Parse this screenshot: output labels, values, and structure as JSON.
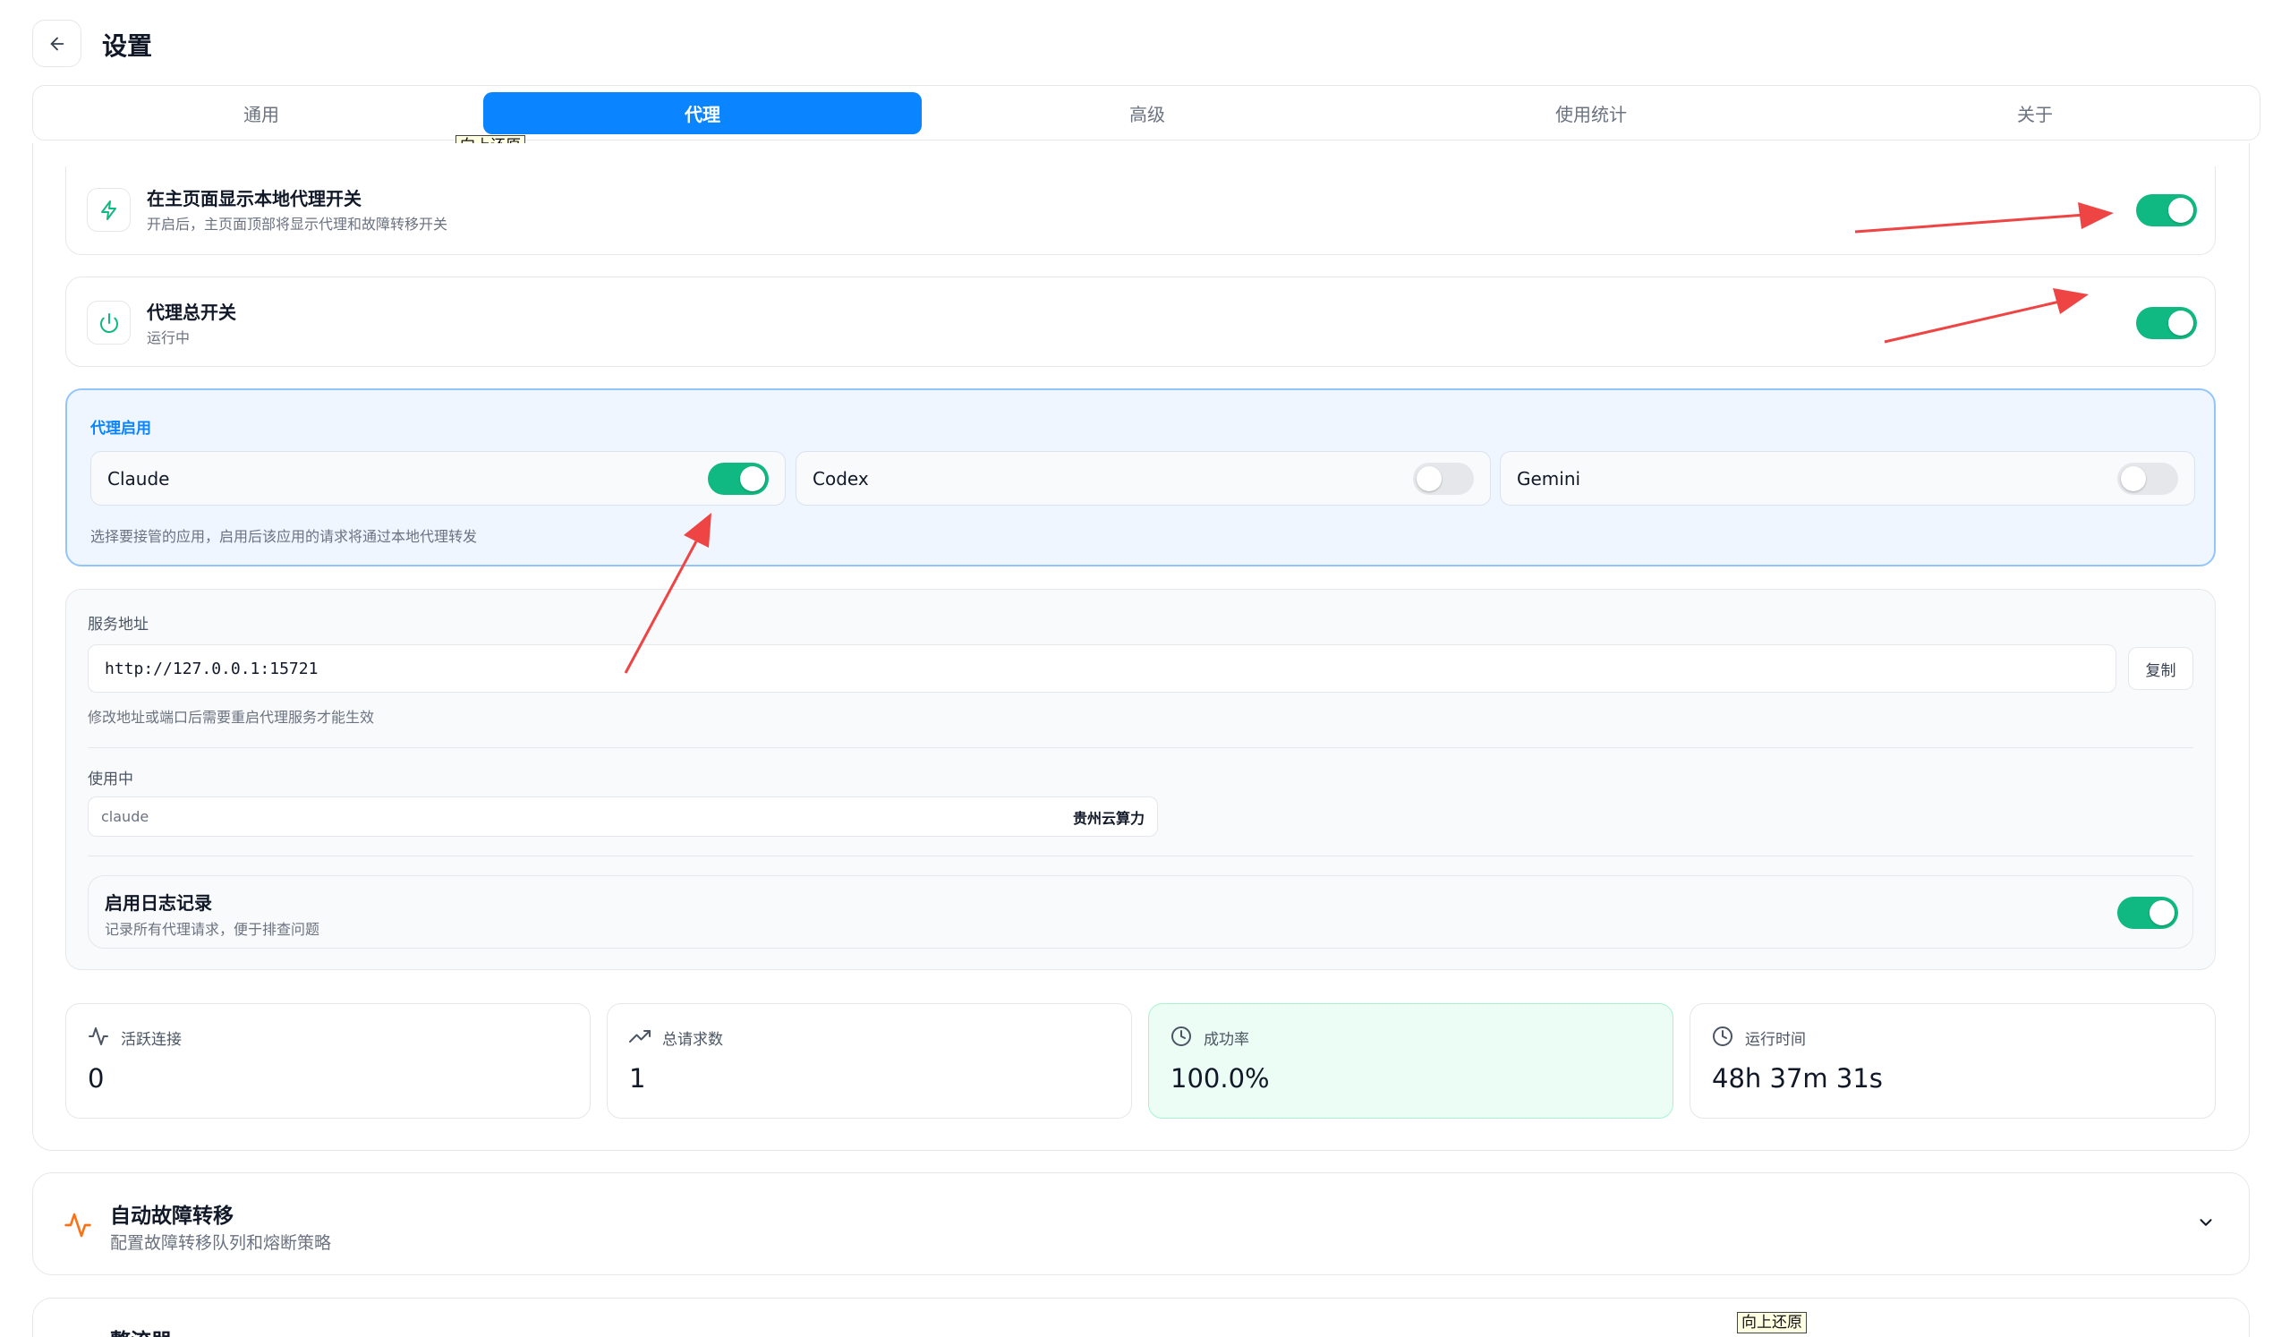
{
  "header": {
    "title": "设置"
  },
  "tabs": [
    "通用",
    "代理",
    "高级",
    "使用统计",
    "关于"
  ],
  "tooltip": {
    "restore_text": "向上还原"
  },
  "proxy": {
    "show_switch": {
      "title": "在主页面显示本地代理开关",
      "desc": "开启后，主页面顶部将显示代理和故障转移开关",
      "enabled": true
    },
    "master": {
      "title": "代理总开关",
      "status": "运行中",
      "enabled": true
    },
    "apps": {
      "section_title": "代理启用",
      "items": [
        {
          "name": "Claude",
          "enabled": true
        },
        {
          "name": "Codex",
          "enabled": false
        },
        {
          "name": "Gemini",
          "enabled": false
        }
      ],
      "hint": "选择要接管的应用，启用后该应用的请求将通过本地代理转发"
    },
    "service": {
      "address_label": "服务地址",
      "address_value": "http://127.0.0.1:15721",
      "copy_label": "复制",
      "address_hint": "修改地址或端口后需要重启代理服务才能生效",
      "in_use_label": "使用中",
      "in_use_app": "claude",
      "in_use_provider": "贵州云算力",
      "logging_title": "启用日志记录",
      "logging_desc": "记录所有代理请求，便于排查问题",
      "logging_enabled": true
    },
    "stats": [
      {
        "label": "活跃连接",
        "value": "0",
        "icon": "activity-icon"
      },
      {
        "label": "总请求数",
        "value": "1",
        "icon": "trending-up-icon"
      },
      {
        "label": "成功率",
        "value": "100.0%",
        "icon": "clock-icon"
      },
      {
        "label": "运行时间",
        "value": "48h 37m 31s",
        "icon": "clock-icon"
      }
    ]
  },
  "failover": {
    "title": "自动故障转移",
    "desc": "配置故障转移队列和熔断策略"
  },
  "next_section": {
    "title": "整流器"
  },
  "colors": {
    "accent": "#0a84ff",
    "toggle_on": "#10b981",
    "annotation_arrow": "#ef4444",
    "failover_icon": "#f97316"
  }
}
